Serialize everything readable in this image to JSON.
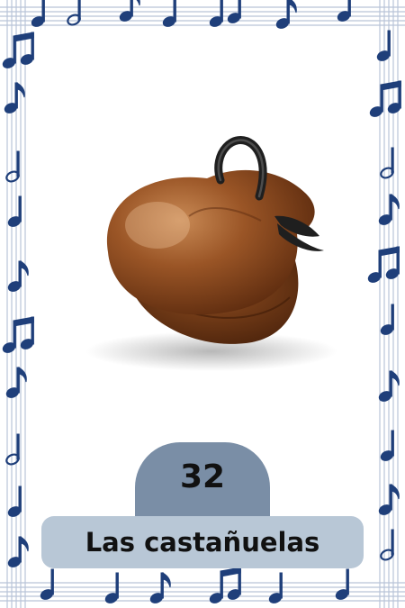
{
  "card": {
    "number": "32",
    "name": "Las castañuelas"
  },
  "colors": {
    "background": "#ffffff",
    "staff_lines": "#b9c4d8",
    "notes": "#1f3f7a",
    "number_tab": "#7a8ea6",
    "name_pill": "#b8c7d6",
    "castanet_wood": "#8a4a1f",
    "castanet_cord": "#222222"
  },
  "icons": {
    "border": "music-note-icon",
    "illustration": "castanets-icon"
  }
}
